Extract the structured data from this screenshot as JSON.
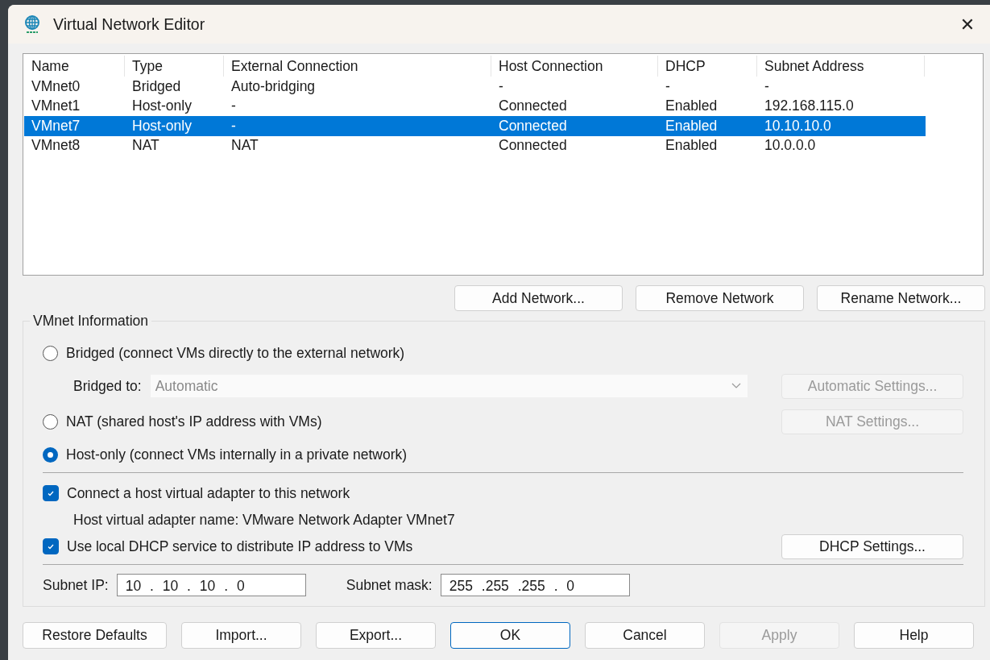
{
  "window": {
    "title": "Virtual Network Editor",
    "close": "✕"
  },
  "table": {
    "columns": [
      {
        "label": "Name"
      },
      {
        "label": "Type"
      },
      {
        "label": "External Connection"
      },
      {
        "label": "Host Connection"
      },
      {
        "label": "DHCP"
      },
      {
        "label": "Subnet Address"
      }
    ],
    "rows": [
      {
        "cells": [
          "VMnet0",
          "Bridged",
          "Auto-bridging",
          "-",
          "-",
          "-"
        ],
        "selected": false
      },
      {
        "cells": [
          "VMnet1",
          "Host-only",
          "-",
          "Connected",
          "Enabled",
          "192.168.115.0"
        ],
        "selected": false
      },
      {
        "cells": [
          "VMnet7",
          "Host-only",
          "-",
          "Connected",
          "Enabled",
          "10.10.10.0"
        ],
        "selected": true
      },
      {
        "cells": [
          "VMnet8",
          "NAT",
          "NAT",
          "Connected",
          "Enabled",
          "10.0.0.0"
        ],
        "selected": false
      }
    ]
  },
  "network_buttons": [
    {
      "label": "Add Network..."
    },
    {
      "label": "Remove Network"
    },
    {
      "label": "Rename Network..."
    }
  ],
  "info": {
    "title": "VMnet Information",
    "bridged": {
      "label": "Bridged (connect VMs directly to the external network)",
      "selected": false
    },
    "bridged_to": {
      "label": "Bridged to:",
      "value": "Automatic",
      "disabled": true,
      "button": {
        "label": "Automatic Settings...",
        "disabled": true
      }
    },
    "nat": {
      "label": "NAT (shared host's IP address with VMs)",
      "selected": false,
      "button": {
        "label": "NAT Settings...",
        "disabled": true
      }
    },
    "host_only": {
      "label": "Host-only (connect VMs internally in a private network)",
      "selected": true
    },
    "connect_adapter": {
      "label": "Connect a host virtual adapter to this network",
      "checked": true
    },
    "adapter_name": "Host virtual adapter name: VMware Network Adapter VMnet7",
    "use_dhcp": {
      "label": "Use local DHCP service to distribute IP address to VMs",
      "checked": true,
      "button": {
        "label": "DHCP Settings...",
        "disabled": false
      }
    },
    "subnet_ip": {
      "label": "Subnet IP:",
      "value": "10 . 10 . 10 . 0"
    },
    "subnet_mask": {
      "label": "Subnet mask:",
      "value": "255 .255 .255 . 0"
    }
  },
  "bottom_buttons": [
    {
      "label": "Restore Defaults",
      "disabled": false,
      "default": false
    },
    {
      "label": "Import...",
      "disabled": false,
      "default": false
    },
    {
      "label": "Export...",
      "disabled": false,
      "default": false
    },
    {
      "label": "OK",
      "disabled": false,
      "default": true
    },
    {
      "label": "Cancel",
      "disabled": false,
      "default": false
    },
    {
      "label": "Apply",
      "disabled": true,
      "default": false
    },
    {
      "label": "Help",
      "disabled": false,
      "default": false
    }
  ]
}
